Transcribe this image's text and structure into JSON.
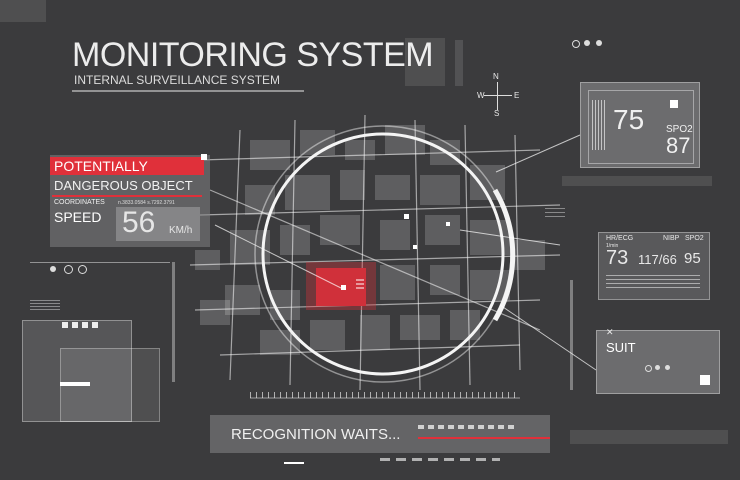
{
  "header": {
    "title": "MONITORING SYSTEM",
    "subtitle": "INTERNAL SURVEILLANCE SYSTEM"
  },
  "compass": {
    "n": "N",
    "s": "S",
    "e": "E",
    "w": "W"
  },
  "alert": {
    "line1": "POTENTIALLY",
    "line2": "DANGEROUS OBJECT",
    "coordinates_label": "COORDINATES",
    "coordinates_value": "n.3833.0584  s.7292.3791",
    "speed_label": "SPEED",
    "speed_value": "56",
    "speed_unit": "KM/h"
  },
  "monitor_top": {
    "value": "75",
    "spo2_label": "SPO2",
    "spo2_value": "87"
  },
  "vitals": {
    "hr_label": "HR/ECG",
    "hr_unit": "1/min",
    "hr_value": "73",
    "nibp_label": "NIBP",
    "nibp_value": "117/66",
    "spo2_label": "SPO2",
    "spo2_value": "95"
  },
  "suit": {
    "label": "SUIT"
  },
  "status": {
    "text": "RECOGNITION WAITS..."
  },
  "colors": {
    "accent": "#e0303a",
    "panel": "#6e6e70",
    "bg": "#3b3b3d"
  }
}
